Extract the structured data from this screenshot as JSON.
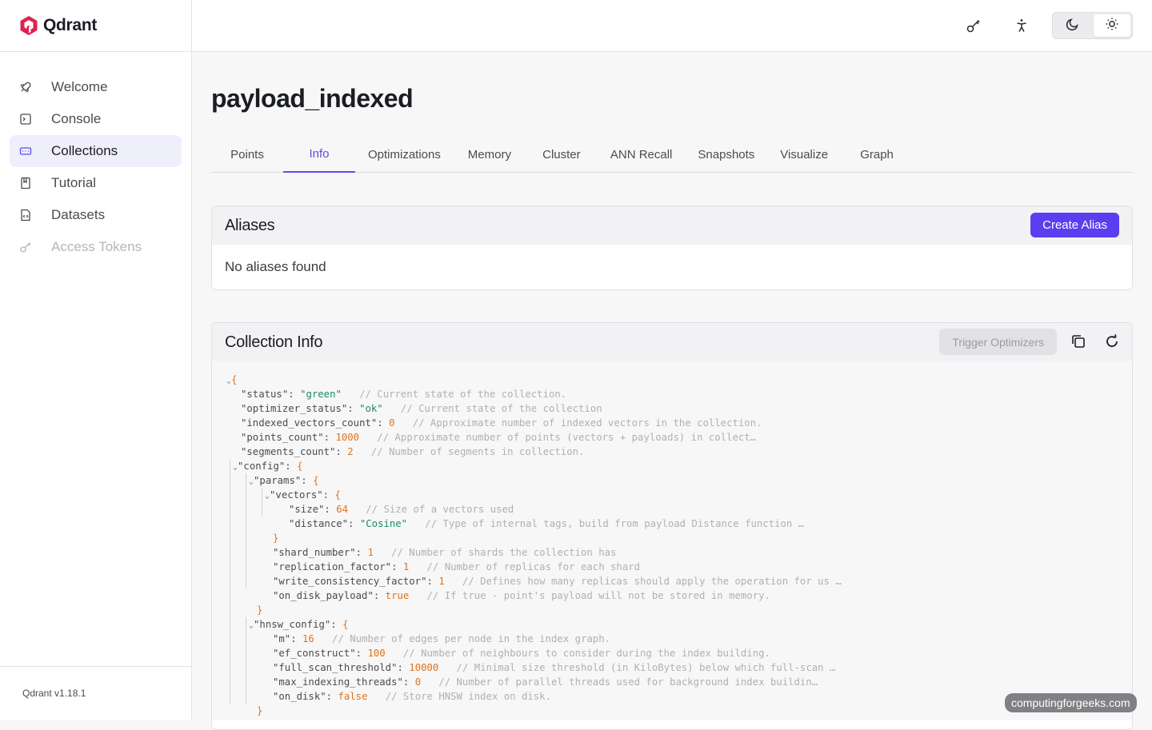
{
  "app": {
    "name": "Qdrant",
    "version": "Qdrant v1.18.1"
  },
  "sidebar": {
    "items": [
      {
        "label": "Welcome",
        "icon": "rocket-icon"
      },
      {
        "label": "Console",
        "icon": "terminal-icon"
      },
      {
        "label": "Collections",
        "icon": "collections-icon",
        "active": true
      },
      {
        "label": "Tutorial",
        "icon": "book-icon"
      },
      {
        "label": "Datasets",
        "icon": "dataset-file-icon"
      },
      {
        "label": "Access Tokens",
        "icon": "key-icon",
        "disabled": true
      }
    ]
  },
  "header": {
    "icons": [
      "key-icon",
      "accessibility-icon"
    ],
    "theme": {
      "options": [
        "moon-icon",
        "sun-icon"
      ],
      "selected": "sun-icon"
    }
  },
  "page": {
    "title": "payload_indexed",
    "tabs": [
      "Points",
      "Info",
      "Optimizations",
      "Memory",
      "Cluster",
      "ANN Recall",
      "Snapshots",
      "Visualize",
      "Graph"
    ],
    "active_tab": "Info"
  },
  "aliases": {
    "title": "Aliases",
    "create_label": "Create Alias",
    "empty_text": "No aliases found"
  },
  "collection_info": {
    "title": "Collection Info",
    "trigger_label": "Trigger Optimizers",
    "lines": [
      {
        "caret": true,
        "parts": [
          [
            "p",
            "{"
          ]
        ]
      },
      {
        "parts": [
          [
            "k",
            "\"status\""
          ],
          [
            "k",
            ": "
          ],
          [
            "s",
            "\"green\""
          ],
          [
            "c",
            "   // Current state of the collection."
          ]
        ]
      },
      {
        "parts": [
          [
            "k",
            "\"optimizer_status\""
          ],
          [
            "k",
            ": "
          ],
          [
            "s",
            "\"ok\""
          ],
          [
            "c",
            "   // Current state of the collection"
          ]
        ]
      },
      {
        "parts": [
          [
            "k",
            "\"indexed_vectors_count\""
          ],
          [
            "k",
            ": "
          ],
          [
            "n",
            "0"
          ],
          [
            "c",
            "   // Approximate number of indexed vectors in the collection."
          ]
        ]
      },
      {
        "parts": [
          [
            "k",
            "\"points_count\""
          ],
          [
            "k",
            ": "
          ],
          [
            "n",
            "1000"
          ],
          [
            "c",
            "   // Approximate number of points (vectors + payloads) in collect…"
          ]
        ]
      },
      {
        "parts": [
          [
            "k",
            "\"segments_count\""
          ],
          [
            "k",
            ": "
          ],
          [
            "n",
            "2"
          ],
          [
            "c",
            "   // Number of segments in collection."
          ]
        ]
      },
      {
        "caret": true,
        "parts": [
          [
            "k",
            "\"config\""
          ],
          [
            "k",
            ": "
          ],
          [
            "p",
            "{"
          ]
        ]
      },
      {
        "caret": true,
        "parts": [
          [
            "k",
            "\"params\""
          ],
          [
            "k",
            ": "
          ],
          [
            "p",
            "{"
          ]
        ]
      },
      {
        "caret": true,
        "parts": [
          [
            "k",
            "\"vectors\""
          ],
          [
            "k",
            ": "
          ],
          [
            "p",
            "{"
          ]
        ]
      },
      {
        "parts": [
          [
            "k",
            "\"size\""
          ],
          [
            "k",
            ": "
          ],
          [
            "n",
            "64"
          ],
          [
            "c",
            "   // Size of a vectors used"
          ]
        ]
      },
      {
        "parts": [
          [
            "k",
            "\"distance\""
          ],
          [
            "k",
            ": "
          ],
          [
            "s",
            "\"Cosine\""
          ],
          [
            "c",
            "   // Type of internal tags, build from payload Distance function …"
          ]
        ]
      },
      {
        "parts": [
          [
            "p",
            "}"
          ]
        ]
      },
      {
        "parts": [
          [
            "k",
            "\"shard_number\""
          ],
          [
            "k",
            ": "
          ],
          [
            "n",
            "1"
          ],
          [
            "c",
            "   // Number of shards the collection has"
          ]
        ]
      },
      {
        "parts": [
          [
            "k",
            "\"replication_factor\""
          ],
          [
            "k",
            ": "
          ],
          [
            "n",
            "1"
          ],
          [
            "c",
            "   // Number of replicas for each shard"
          ]
        ]
      },
      {
        "parts": [
          [
            "k",
            "\"write_consistency_factor\""
          ],
          [
            "k",
            ": "
          ],
          [
            "n",
            "1"
          ],
          [
            "c",
            "   // Defines how many replicas should apply the operation for us …"
          ]
        ]
      },
      {
        "parts": [
          [
            "k",
            "\"on_disk_payload\""
          ],
          [
            "k",
            ": "
          ],
          [
            "b",
            "true"
          ],
          [
            "c",
            "   // If true - point's payload will not be stored in memory."
          ]
        ]
      },
      {
        "parts": [
          [
            "p",
            "}"
          ]
        ]
      },
      {
        "caret": true,
        "parts": [
          [
            "k",
            "\"hnsw_config\""
          ],
          [
            "k",
            ": "
          ],
          [
            "p",
            "{"
          ]
        ]
      },
      {
        "parts": [
          [
            "k",
            "\"m\""
          ],
          [
            "k",
            ": "
          ],
          [
            "n",
            "16"
          ],
          [
            "c",
            "   // Number of edges per node in the index graph."
          ]
        ]
      },
      {
        "parts": [
          [
            "k",
            "\"ef_construct\""
          ],
          [
            "k",
            ": "
          ],
          [
            "n",
            "100"
          ],
          [
            "c",
            "   // Number of neighbours to consider during the index building."
          ]
        ]
      },
      {
        "parts": [
          [
            "k",
            "\"full_scan_threshold\""
          ],
          [
            "k",
            ": "
          ],
          [
            "n",
            "10000"
          ],
          [
            "c",
            "   // Minimal size threshold (in KiloBytes) below which full-scan …"
          ]
        ]
      },
      {
        "parts": [
          [
            "k",
            "\"max_indexing_threads\""
          ],
          [
            "k",
            ": "
          ],
          [
            "n",
            "0"
          ],
          [
            "c",
            "   // Number of parallel threads used for background index buildin…"
          ]
        ]
      },
      {
        "parts": [
          [
            "k",
            "\"on_disk\""
          ],
          [
            "k",
            ": "
          ],
          [
            "b",
            "false"
          ],
          [
            "c",
            "   // Store HNSW index on disk."
          ]
        ]
      },
      {
        "parts": [
          [
            "p",
            "}"
          ]
        ]
      }
    ]
  },
  "watermark": "computingforgeeks.com",
  "colors": {
    "accent": "#5b4ee6",
    "primary_button": "#5b3ef0",
    "brand": "#dc244c"
  }
}
